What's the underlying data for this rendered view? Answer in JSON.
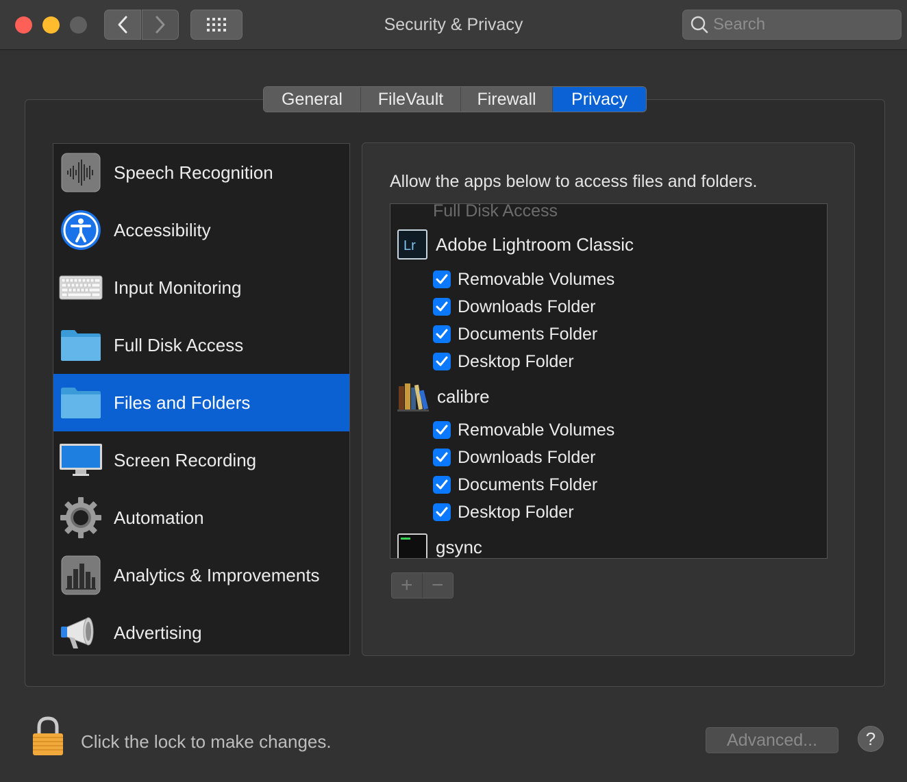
{
  "window": {
    "title": "Security & Privacy",
    "search_placeholder": "Search"
  },
  "tabs": [
    {
      "label": "General",
      "active": false
    },
    {
      "label": "FileVault",
      "active": false
    },
    {
      "label": "Firewall",
      "active": false
    },
    {
      "label": "Privacy",
      "active": true
    }
  ],
  "sidebar": {
    "items": [
      {
        "label": "Speech Recognition",
        "icon": "waveform-icon"
      },
      {
        "label": "Accessibility",
        "icon": "accessibility-icon"
      },
      {
        "label": "Input Monitoring",
        "icon": "keyboard-icon"
      },
      {
        "label": "Full Disk Access",
        "icon": "folder-icon"
      },
      {
        "label": "Files and Folders",
        "icon": "folder-icon",
        "selected": true
      },
      {
        "label": "Screen Recording",
        "icon": "display-icon"
      },
      {
        "label": "Automation",
        "icon": "gear-icon"
      },
      {
        "label": "Analytics & Improvements",
        "icon": "bar-chart-icon"
      },
      {
        "label": "Advertising",
        "icon": "megaphone-icon"
      }
    ]
  },
  "panel": {
    "description": "Allow the apps below to access files and folders.",
    "section_header": "Full Disk Access",
    "apps": [
      {
        "name": "Adobe Lightroom Classic",
        "icon": "lightroom-icon",
        "permissions": [
          {
            "label": "Removable Volumes",
            "checked": true
          },
          {
            "label": "Downloads Folder",
            "checked": true
          },
          {
            "label": "Documents Folder",
            "checked": true
          },
          {
            "label": "Desktop Folder",
            "checked": true
          }
        ]
      },
      {
        "name": "calibre",
        "icon": "calibre-books-icon",
        "permissions": [
          {
            "label": "Removable Volumes",
            "checked": true
          },
          {
            "label": "Downloads Folder",
            "checked": true
          },
          {
            "label": "Documents Folder",
            "checked": true
          },
          {
            "label": "Desktop Folder",
            "checked": true
          }
        ]
      },
      {
        "name": "gsync",
        "icon": "terminal-exec-icon",
        "permissions": []
      }
    ],
    "add_label": "+",
    "remove_label": "−"
  },
  "footer": {
    "lock_text": "Click the lock to make changes.",
    "advanced_label": "Advanced...",
    "help_label": "?"
  },
  "colors": {
    "accent": "#0a62d4",
    "checkbox": "#0a79ff",
    "window_bg": "#323232"
  }
}
